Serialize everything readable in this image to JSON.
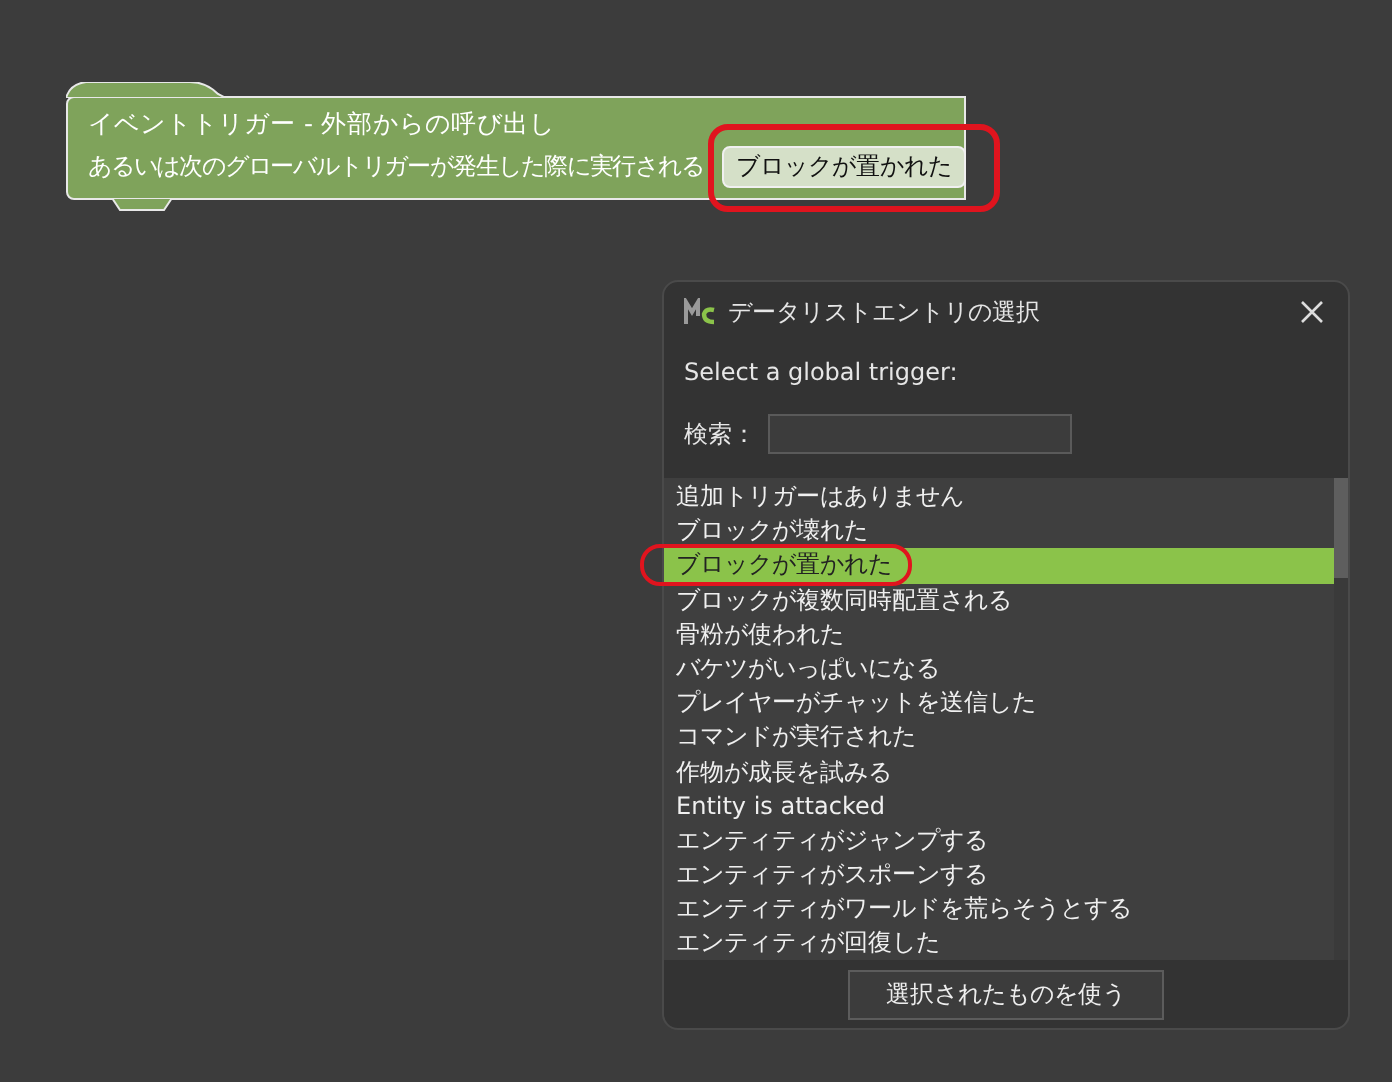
{
  "block": {
    "title": "イベントトリガー - 外部からの呼び出し",
    "text": "あるいは次のグローバルトリガーが発生した際に実行される",
    "value": {
      "label": "ブロックが置かれた",
      "highlighted": true
    }
  },
  "dialog": {
    "title": "データリストエントリの選択",
    "prompt": "Select a global trigger:",
    "search": {
      "label": "検索："
    },
    "items": [
      {
        "label": "追加トリガーはありません",
        "selected": false,
        "highlighted": false
      },
      {
        "label": "ブロックが壊れた",
        "selected": false,
        "highlighted": false
      },
      {
        "label": "ブロックが置かれた",
        "selected": true,
        "highlighted": true
      },
      {
        "label": "ブロックが複数同時配置される",
        "selected": false,
        "highlighted": false
      },
      {
        "label": "骨粉が使われた",
        "selected": false,
        "highlighted": false
      },
      {
        "label": "バケツがいっぱいになる",
        "selected": false,
        "highlighted": false
      },
      {
        "label": "プレイヤーがチャットを送信した",
        "selected": false,
        "highlighted": false
      },
      {
        "label": "コマンドが実行された",
        "selected": false,
        "highlighted": false
      },
      {
        "label": "作物が成長を試みる",
        "selected": false,
        "highlighted": false
      },
      {
        "label": "Entity is attacked",
        "selected": false,
        "highlighted": false
      },
      {
        "label": "エンティティがジャンプする",
        "selected": false,
        "highlighted": false
      },
      {
        "label": "エンティティがスポーンする",
        "selected": false,
        "highlighted": false
      },
      {
        "label": "エンティティがワールドを荒らそうとする",
        "selected": false,
        "highlighted": false
      },
      {
        "label": "エンティティが回復した",
        "selected": false,
        "highlighted": false
      }
    ],
    "button": "選択されたものを使う"
  }
}
